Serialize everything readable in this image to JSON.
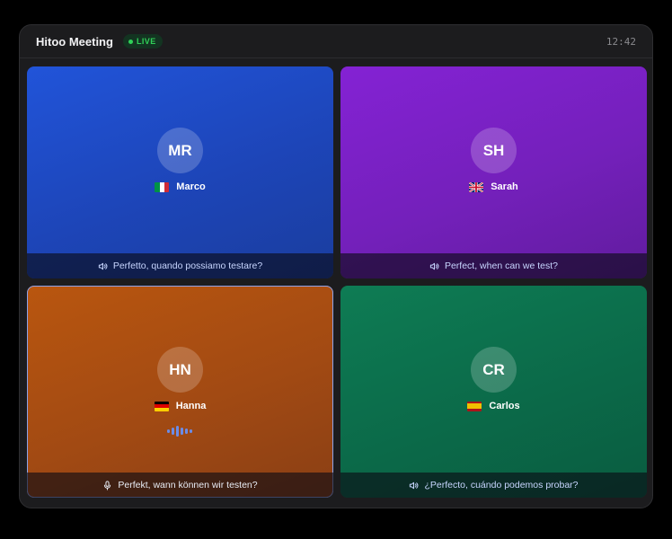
{
  "header": {
    "title": "Hitoo Meeting",
    "live_label": "LIVE",
    "time": "12:42"
  },
  "colors": {
    "live_green": "#30d158",
    "caption_text": "#c8d6ff",
    "tile_blue": "#1d45b8",
    "tile_purple": "#7420bb",
    "tile_orange": "#a24a13",
    "tile_green": "#0b6a49",
    "active_border": "#8ea2e8"
  },
  "participants": [
    {
      "initials": "MR",
      "name": "Marco",
      "flag": "italy-flag-icon",
      "caption_icon": "speaker-icon",
      "caption": "Perfetto, quando possiamo testare?",
      "speaking": false
    },
    {
      "initials": "SH",
      "name": "Sarah",
      "flag": "uk-flag-icon",
      "caption_icon": "speaker-icon",
      "caption": "Perfect, when can we test?",
      "speaking": false
    },
    {
      "initials": "HN",
      "name": "Hanna",
      "flag": "germany-flag-icon",
      "caption_icon": "microphone-icon",
      "caption": "Perfekt, wann können wir testen?",
      "speaking": true
    },
    {
      "initials": "CR",
      "name": "Carlos",
      "flag": "spain-flag-icon",
      "caption_icon": "speaker-icon",
      "caption": "¿Perfecto, cuándo podemos probar?",
      "speaking": false
    }
  ]
}
